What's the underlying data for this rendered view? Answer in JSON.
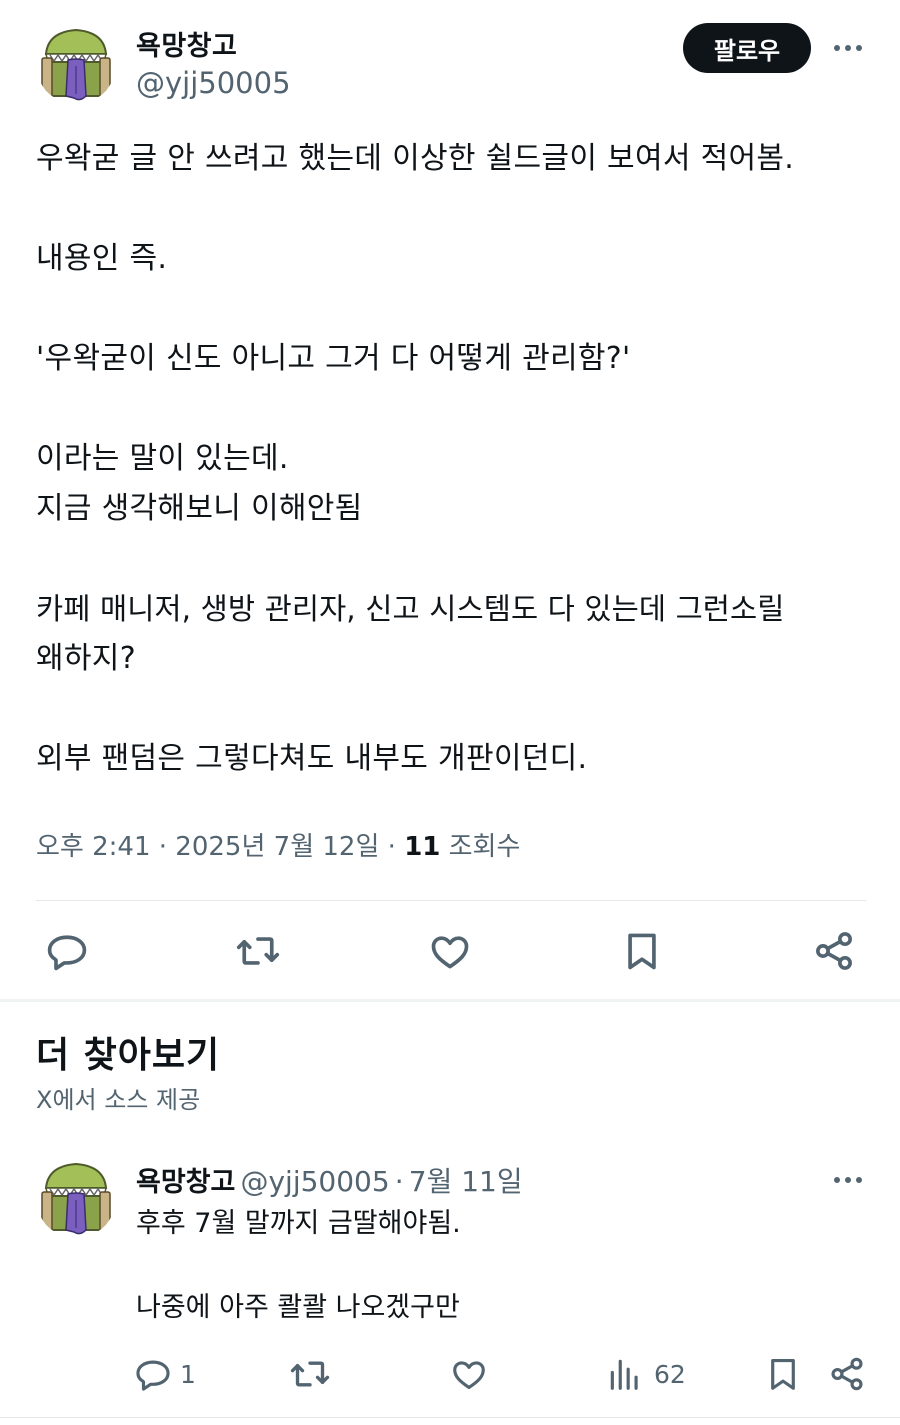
{
  "main_tweet": {
    "author_name": "욕망창고",
    "author_handle": "@yjj50005",
    "follow_label": "팔로우",
    "lines": [
      "우왁굳 글 안 쓰려고 했는데 이상한 쉴드글이 보여서 적어봄.",
      "내용인 즉.",
      "'우왁굳이 신도 아니고 그거 다 어떻게 관리함?'",
      "이라는 말이 있는데.",
      "지금 생각해보니 이해안됨",
      "카페 매니저, 생방 관리자, 신고 시스템도 다 있는데 그런소릴",
      "왜하지?",
      "외부 팬덤은 그렇다쳐도 내부도 개판이던디."
    ],
    "time": "오후 2:41",
    "date": "2025년 7월 12일",
    "views_count": "11",
    "views_label": "조회수",
    "separator": "·"
  },
  "actions": {
    "icons": [
      "reply-icon",
      "retweet-icon",
      "like-icon",
      "bookmark-icon",
      "share-icon"
    ]
  },
  "discover": {
    "title": "더 찾아보기",
    "subtitle": "X에서 소스 제공"
  },
  "rec_tweet": {
    "author_name": "욕망창고",
    "author_handle": "@yjj50005",
    "date": "7월 11일",
    "separator": "·",
    "lines": [
      "후후 7월 말까지 금딸해야됨.",
      "나중에 아주 콸콸 나오겠구만"
    ],
    "reply_count": "1",
    "views_count": "62"
  },
  "colors": {
    "text": "#0f1419",
    "secondary": "#536471",
    "follow_bg": "#0f1419",
    "divider": "#eff3f4"
  }
}
